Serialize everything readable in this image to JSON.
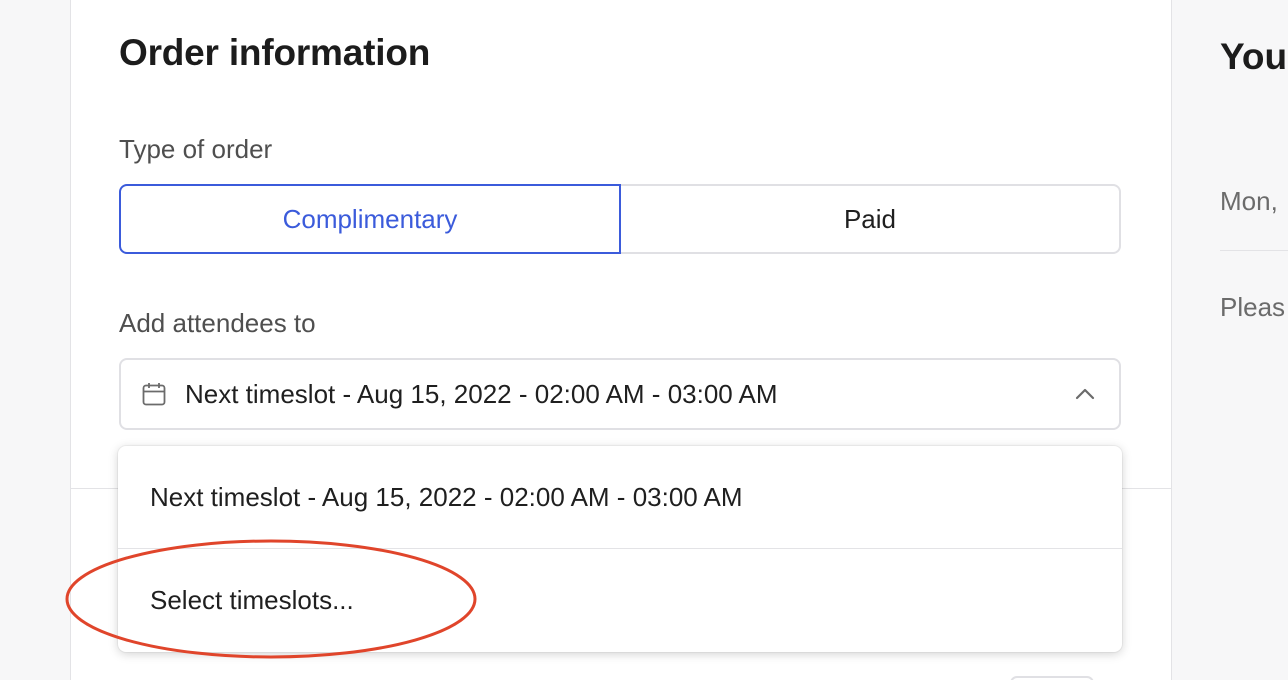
{
  "order_panel": {
    "title": "Order information",
    "type_label": "Type of order",
    "type_options": [
      "Complimentary",
      "Paid"
    ],
    "type_selected": "Complimentary",
    "attendees_label": "Add attendees to",
    "timeslot_select": {
      "value": "Next timeslot - Aug 15, 2022 - 02:00 AM - 03:00 AM",
      "expanded": true
    },
    "dropdown_options": [
      "Next timeslot - Aug 15, 2022 - 02:00 AM - 03:00 AM",
      "Select timeslots..."
    ]
  },
  "side_panel": {
    "title": "You",
    "date_text": "Mon,",
    "note_text": "Pleas"
  },
  "colors": {
    "accent": "#3b5bdb",
    "highlight_circle": "#e0452b",
    "border": "#e0e0e4"
  },
  "icons": {
    "calendar": "calendar-icon",
    "chevron": "chevron-up-icon"
  }
}
